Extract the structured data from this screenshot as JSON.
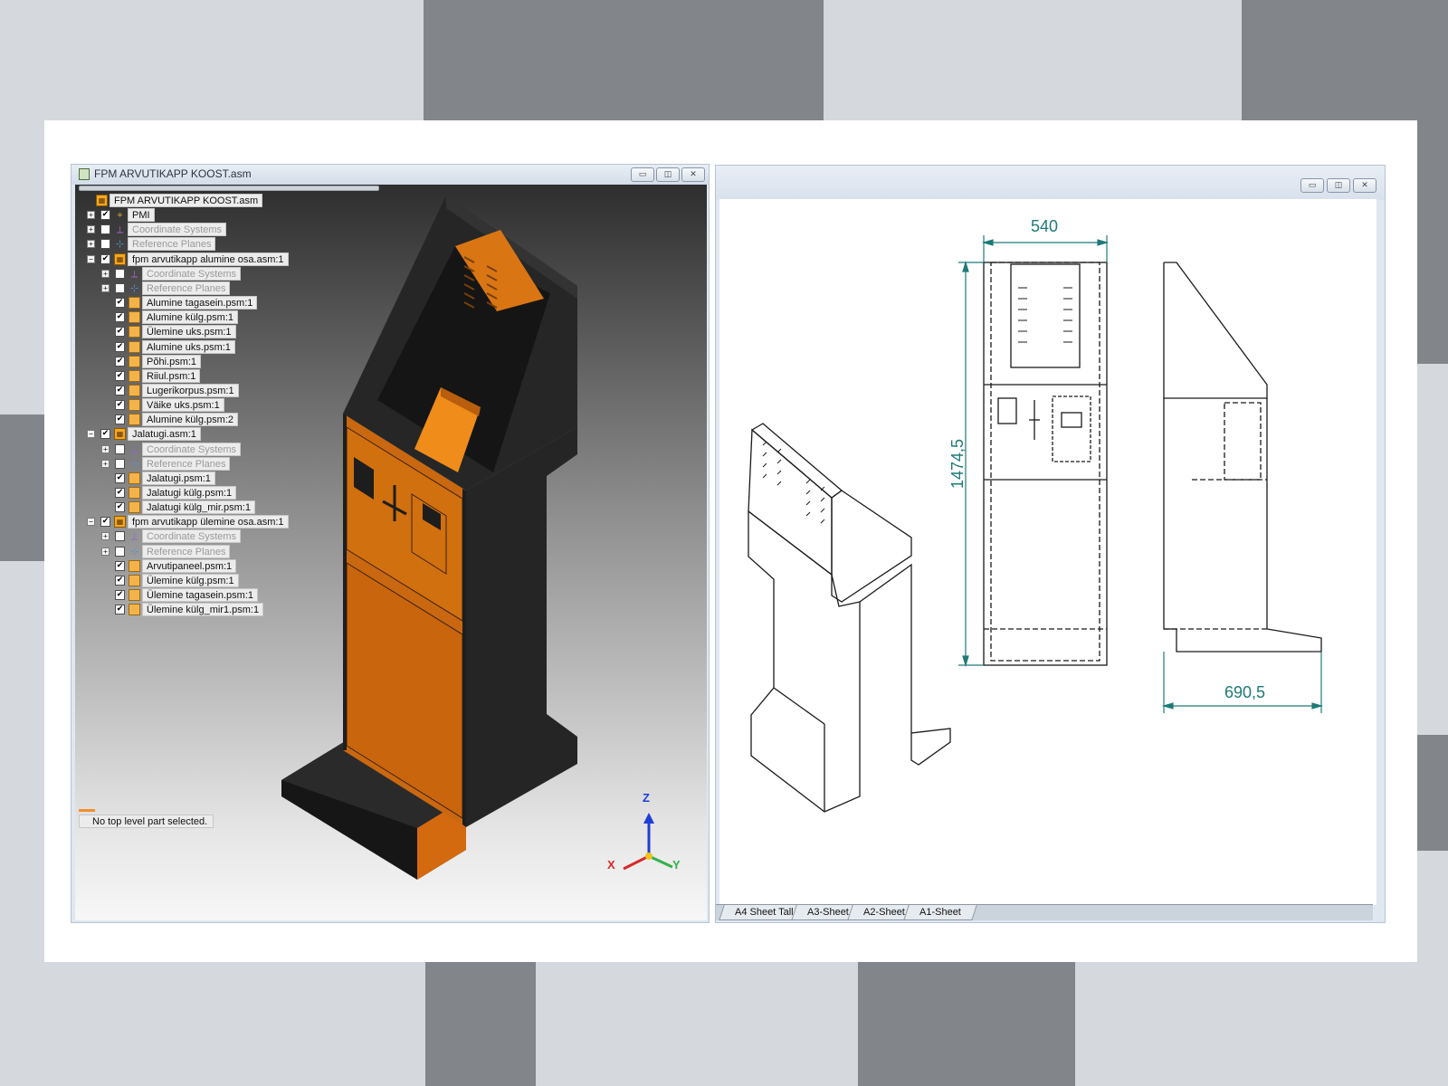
{
  "assembly_window": {
    "title": "FPM ARVUTIKAPP KOOST.asm",
    "controls": {
      "minimize": "▭",
      "maximize": "◫",
      "close": "✕"
    },
    "tree": [
      {
        "label": "FPM ARVUTIKAPP KOOST.asm",
        "icon": "assembly-icon",
        "level": 0,
        "expander": "",
        "checked": null,
        "dim": false
      },
      {
        "label": "PMI",
        "icon": "pmi-icon",
        "level": 1,
        "expander": "+",
        "checked": true,
        "dim": false
      },
      {
        "label": "Coordinate Systems",
        "icon": "coordinate-system-icon",
        "level": 1,
        "expander": "+",
        "checked": false,
        "dim": true
      },
      {
        "label": "Reference Planes",
        "icon": "reference-plane-icon",
        "level": 1,
        "expander": "+",
        "checked": false,
        "dim": true
      },
      {
        "label": "fpm arvutikapp alumine osa.asm:1",
        "icon": "assembly-icon",
        "level": 1,
        "expander": "−",
        "checked": true,
        "dim": false
      },
      {
        "label": "Coordinate Systems",
        "icon": "coordinate-system-icon",
        "level": 2,
        "expander": "+",
        "checked": false,
        "dim": true
      },
      {
        "label": "Reference Planes",
        "icon": "reference-plane-icon",
        "level": 2,
        "expander": "+",
        "checked": false,
        "dim": true
      },
      {
        "label": "Alumine tagasein.psm:1",
        "icon": "sheetmetal-part-icon",
        "level": 2,
        "expander": "",
        "checked": true,
        "dim": false
      },
      {
        "label": "Alumine külg.psm:1",
        "icon": "sheetmetal-part-icon",
        "level": 2,
        "expander": "",
        "checked": true,
        "dim": false
      },
      {
        "label": "Ülemine uks.psm:1",
        "icon": "sheetmetal-part-icon",
        "level": 2,
        "expander": "",
        "checked": true,
        "dim": false
      },
      {
        "label": "Alumine uks.psm:1",
        "icon": "sheetmetal-part-icon",
        "level": 2,
        "expander": "",
        "checked": true,
        "dim": false
      },
      {
        "label": "Põhi.psm:1",
        "icon": "sheetmetal-part-icon",
        "level": 2,
        "expander": "",
        "checked": true,
        "dim": false
      },
      {
        "label": "Riiul.psm:1",
        "icon": "sheetmetal-part-icon",
        "level": 2,
        "expander": "",
        "checked": true,
        "dim": false
      },
      {
        "label": "Lugerikorpus.psm:1",
        "icon": "sheetmetal-part-icon",
        "level": 2,
        "expander": "",
        "checked": true,
        "dim": false
      },
      {
        "label": "Väike uks.psm:1",
        "icon": "sheetmetal-part-icon",
        "level": 2,
        "expander": "",
        "checked": true,
        "dim": false
      },
      {
        "label": "Alumine külg.psm:2",
        "icon": "sheetmetal-part-icon",
        "level": 2,
        "expander": "",
        "checked": true,
        "dim": false
      },
      {
        "label": "Jalatugi.asm:1",
        "icon": "assembly-icon",
        "level": 1,
        "expander": "−",
        "checked": true,
        "dim": false
      },
      {
        "label": "Coordinate Systems",
        "icon": "coordinate-system-icon",
        "level": 2,
        "expander": "+",
        "checked": false,
        "dim": true
      },
      {
        "label": "Reference Planes",
        "icon": "reference-plane-icon",
        "level": 2,
        "expander": "+",
        "checked": false,
        "dim": true
      },
      {
        "label": "Jalatugi.psm:1",
        "icon": "sheetmetal-part-icon",
        "level": 2,
        "expander": "",
        "checked": true,
        "dim": false
      },
      {
        "label": "Jalatugi külg.psm:1",
        "icon": "sheetmetal-part-icon",
        "level": 2,
        "expander": "",
        "checked": true,
        "dim": false
      },
      {
        "label": "Jalatugi külg_mir.psm:1",
        "icon": "sheetmetal-part-icon",
        "level": 2,
        "expander": "",
        "checked": true,
        "dim": false
      },
      {
        "label": "fpm arvutikapp ülemine osa.asm:1",
        "icon": "assembly-icon",
        "level": 1,
        "expander": "−",
        "checked": true,
        "dim": false
      },
      {
        "label": "Coordinate Systems",
        "icon": "coordinate-system-icon",
        "level": 2,
        "expander": "+",
        "checked": false,
        "dim": true
      },
      {
        "label": "Reference Planes",
        "icon": "reference-plane-icon",
        "level": 2,
        "expander": "+",
        "checked": false,
        "dim": true
      },
      {
        "label": "Arvutipaneel.psm:1",
        "icon": "sheetmetal-part-icon",
        "level": 2,
        "expander": "",
        "checked": true,
        "dim": false
      },
      {
        "label": "Ülemine külg.psm:1",
        "icon": "sheetmetal-part-icon",
        "level": 2,
        "expander": "",
        "checked": true,
        "dim": false
      },
      {
        "label": "Ülemine tagasein.psm:1",
        "icon": "sheetmetal-part-icon",
        "level": 2,
        "expander": "",
        "checked": true,
        "dim": false
      },
      {
        "label": "Ülemine külg_mir1.psm:1",
        "icon": "sheetmetal-part-icon",
        "level": 2,
        "expander": "",
        "checked": true,
        "dim": false
      }
    ],
    "status": "No top level part selected.",
    "triad": {
      "z": "Z",
      "x": "X",
      "y": "Y"
    },
    "colors": {
      "panel_orange": "#e07b14",
      "body_dark": "#1e1e1e"
    }
  },
  "drawing_window": {
    "controls": {
      "minimize": "▭",
      "maximize": "◫",
      "close": "✕"
    },
    "dimensions": {
      "width": "540",
      "height": "1474,5",
      "depth": "690,5"
    },
    "sheet_tabs": [
      "A4 Sheet Tall",
      "A3-Sheet",
      "A2-Sheet",
      "A1-Sheet"
    ],
    "colors": {
      "dimension": "#1e7a78"
    }
  }
}
